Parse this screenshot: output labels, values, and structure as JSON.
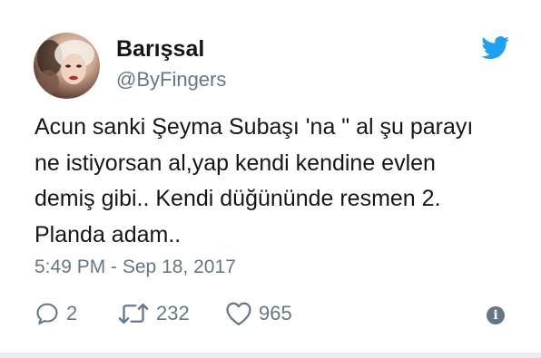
{
  "tweet": {
    "display_name": "Barışsal",
    "handle": "@ByFingers",
    "text_lines": [
      "Acun sanki Şeyma Subaşı 'na \" al şu parayı",
      "ne istiyorsan al,yap kendi kendine evlen",
      "demiş gibi.. Kendi düğününde resmen 2.",
      "Planda adam.."
    ],
    "timestamp": "5:49 PM - Sep 18, 2017",
    "replies": "2",
    "retweets": "232",
    "likes": "965",
    "info_glyph": "i"
  },
  "icons": {
    "brand": "twitter-bird-icon",
    "reply": "reply-icon",
    "retweet": "retweet-icon",
    "like": "heart-icon",
    "info": "info-icon"
  },
  "colors": {
    "brand": "#1da1f2",
    "text": "#14171a",
    "secondary": "#657786"
  }
}
